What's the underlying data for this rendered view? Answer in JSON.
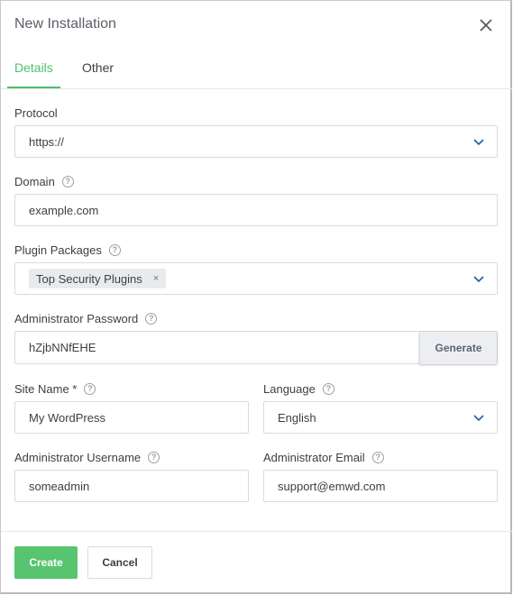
{
  "dialog": {
    "title": "New Installation",
    "close_icon": "close-icon"
  },
  "tabs": [
    {
      "label": "Details",
      "active": true
    },
    {
      "label": "Other",
      "active": false
    }
  ],
  "fields": {
    "protocol": {
      "label": "Protocol",
      "value": "https://"
    },
    "domain": {
      "label": "Domain",
      "value": "example.com"
    },
    "plugin_packages": {
      "label": "Plugin Packages",
      "tags": [
        "Top Security Plugins"
      ],
      "tag_remove": "×"
    },
    "admin_password": {
      "label": "Administrator Password",
      "value": "hZjbNNfEHE",
      "generate_label": "Generate"
    },
    "site_name": {
      "label": "Site Name *",
      "value": "My WordPress"
    },
    "language": {
      "label": "Language",
      "value": "English"
    },
    "admin_username": {
      "label": "Administrator Username",
      "value": "someadmin"
    },
    "admin_email": {
      "label": "Administrator Email",
      "value": "support@emwd.com"
    }
  },
  "help_icon_glyph": "?",
  "footer": {
    "create_label": "Create",
    "cancel_label": "Cancel"
  },
  "colors": {
    "accent": "#4ebf6b",
    "primary_button": "#57c56f"
  }
}
